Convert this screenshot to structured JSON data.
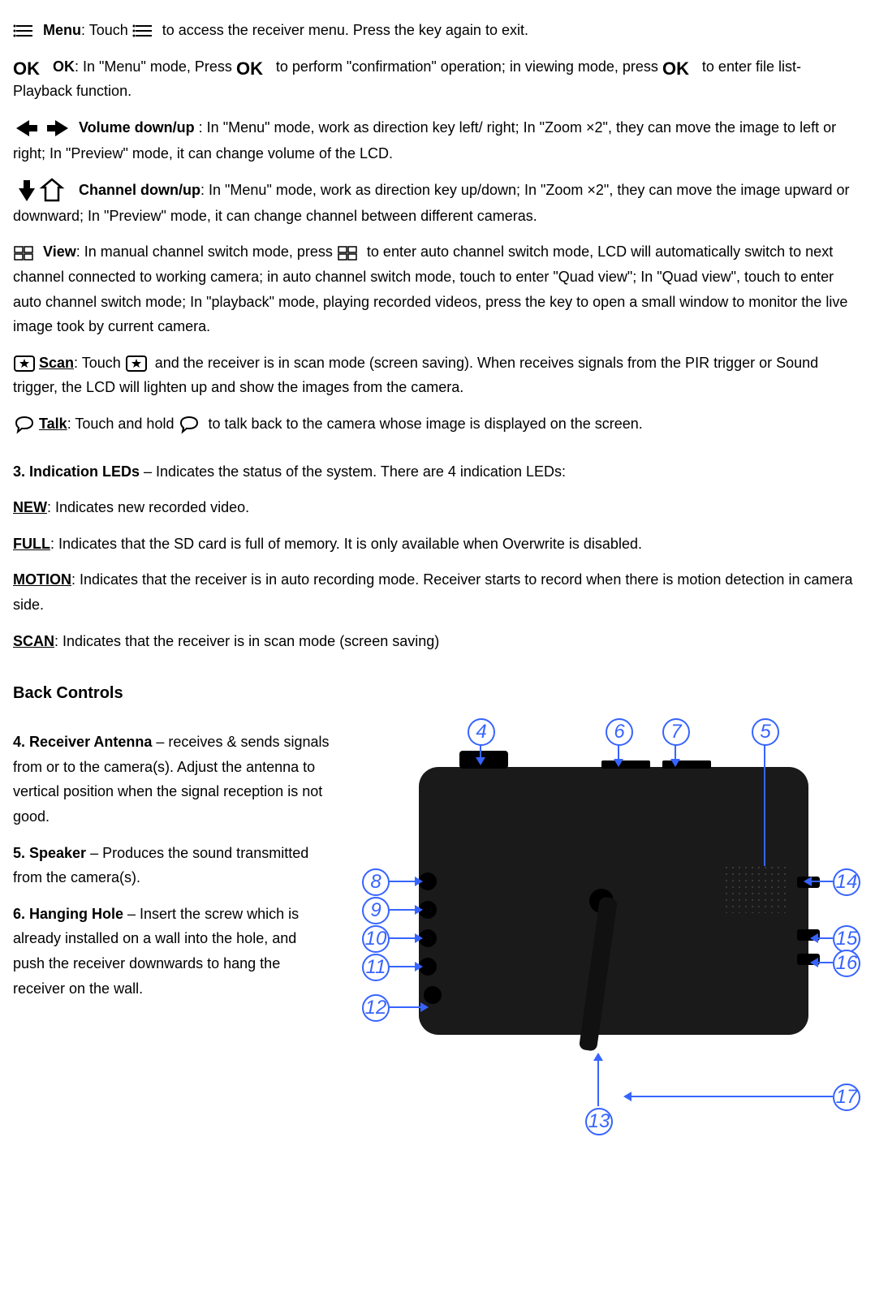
{
  "controls": {
    "menu": {
      "name": "Menu",
      "text1": ": Touch ",
      "text2": " to access the receiver menu. Press the key again to exit."
    },
    "ok": {
      "name": "OK",
      "text1": ": In \"Menu\" mode, Press ",
      "text2": " to perform \"confirmation\" operation; in viewing mode, press ",
      "text3": " to enter file list- Playback function."
    },
    "volume": {
      "name": "Volume down/up",
      "text": " : In \"Menu\" mode, work as direction key left/ right; In \"Zoom  ×2\", they can move the image to left or right; In \"Preview\" mode, it can change volume of the LCD."
    },
    "channel": {
      "name": "Channel down/up",
      "text": ": In \"Menu\" mode, work as direction key up/down; In \"Zoom  ×2\", they can move the image upward or downward; In \"Preview\" mode, it can change channel between different cameras."
    },
    "view": {
      "name": "View",
      "text1": ": In manual channel switch mode, press",
      "text2": " to enter auto channel switch mode, LCD will automatically switch to next channel connected to working camera; in auto channel switch mode, touch to enter \"Quad view\"; In \"Quad view\", touch to enter auto channel switch mode; In \"playback\" mode, playing recorded videos, press the key to open a small window to monitor the live image took by current camera."
    },
    "scan": {
      "name": "Scan",
      "text1": ": Touch ",
      "text2": " and the receiver is in scan mode (screen saving). When receives signals from the PIR trigger or Sound trigger, the LCD will lighten up and show the images from the camera."
    },
    "talk": {
      "name": "Talk",
      "text1": ": Touch and hold ",
      "text2": " to talk back to the camera whose image is displayed on the screen."
    }
  },
  "leds": {
    "heading": "3.   Indication LEDs",
    "heading_rest": " – Indicates the status of the system. There are 4 indication LEDs:",
    "new": {
      "name": "NEW",
      "text": ": Indicates new recorded video."
    },
    "full": {
      "name": "FULL",
      "text": ": Indicates that the SD card is full of memory. It is only available when Overwrite is disabled."
    },
    "motion": {
      "name": "MOTION",
      "text": ": Indicates that the receiver is in auto recording mode. Receiver starts to record when there is motion detection in camera side."
    },
    "scan": {
      "name": "SCAN",
      "text": ": Indicates that the receiver is in scan mode (screen saving)"
    }
  },
  "back": {
    "header": "Back Controls",
    "item4": {
      "name": "4. Receiver Antenna",
      "text": " – receives & sends signals from or to the camera(s). Adjust the antenna to vertical position when the signal reception is not good."
    },
    "item5": {
      "name": "5. Speaker",
      "text": " – Produces the sound transmitted from the camera(s)."
    },
    "item6": {
      "name": "6. Hanging Hole",
      "text": " – Insert the screw which is already installed on a wall into the hole, and push the receiver downwards to hang the receiver on the wall."
    }
  },
  "callouts": {
    "c4": "4",
    "c5": "5",
    "c6": "6",
    "c7": "7",
    "c8": "8",
    "c9": "9",
    "c10": "10",
    "c11": "11",
    "c12": "12",
    "c13": "13",
    "c14": "14",
    "c15": "15",
    "c16": "16",
    "c17": "17"
  }
}
